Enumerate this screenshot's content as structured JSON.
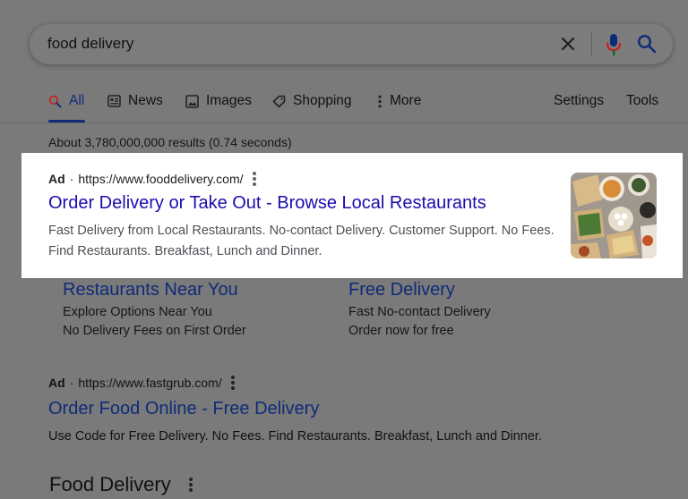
{
  "search": {
    "query": "food delivery"
  },
  "tabs": [
    {
      "label": "All",
      "icon": "search-icon",
      "active": true
    },
    {
      "label": "News",
      "icon": "news-icon"
    },
    {
      "label": "Images",
      "icon": "images-icon"
    },
    {
      "label": "Shopping",
      "icon": "tag-icon"
    },
    {
      "label": "More",
      "icon": "more-vert-icon"
    }
  ],
  "toolbar": {
    "settings_label": "Settings",
    "tools_label": "Tools"
  },
  "results_stats": "About 3,780,000,000 results (0.74 seconds)",
  "ad1": {
    "ad_label": "Ad",
    "separator": "·",
    "url": "https://www.fooddelivery.com/",
    "title": "Order Delivery or Take Out - Browse Local Restaurants",
    "description_line1": "Fast Delivery from Local Restaurants. No-contact Delivery. Customer Support. No Fees.",
    "description_line2": "Find Restaurants. Breakfast, Lunch and Dinner.",
    "sitelinks": [
      {
        "title": "Restaurants Near You",
        "lines": [
          "Explore Options Near You",
          "No Delivery Fees on First Order"
        ]
      },
      {
        "title": "Free Delivery",
        "lines": [
          "Fast No-contact Delivery",
          "Order now for free"
        ]
      }
    ]
  },
  "ad2": {
    "ad_label": "Ad",
    "separator": "·",
    "url": "https://www.fastgrub.com/",
    "title": "Order Food Online - Free Delivery",
    "description": "Use Code for Free Delivery. No Fees. Find Restaurants. Breakfast, Lunch and Dinner."
  },
  "section": {
    "heading": "Food Delivery"
  },
  "colors": {
    "overlay_gray": "#7a7a7a",
    "link_blue": "#1a0dab",
    "dim_link_blue": "#0f2b78",
    "mic_red": "#c5221f",
    "mic_blue": "#0f2b78"
  }
}
